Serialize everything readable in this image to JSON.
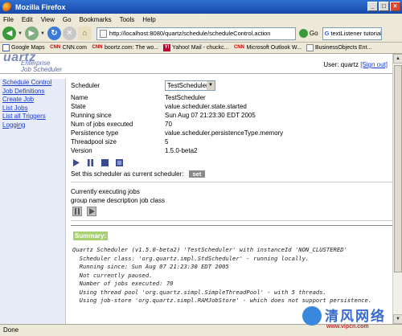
{
  "window": {
    "title": "Mozilla Firefox"
  },
  "menu": [
    "File",
    "Edit",
    "View",
    "Go",
    "Bookmarks",
    "Tools",
    "Help"
  ],
  "address": {
    "url": "http://localhost:8080/quartz/schedule/scheduleControl.action",
    "go_label": "Go"
  },
  "search": {
    "value": "textListener tutorial"
  },
  "bookmarks": [
    "Google Maps",
    "CNN.com",
    "boortz.com: The wo...",
    "Yahoo! Mail - chuckc...",
    "Microsoft Outlook W...",
    "BusinessObjects Ent..."
  ],
  "app": {
    "logo_big": "uartz",
    "logo_line1": "Enterprise",
    "logo_line2": "Job Scheduler",
    "user_label": "User: quartz",
    "sign_out": "[Sign out]"
  },
  "sidebar": {
    "items": [
      {
        "label": "Schedule Control"
      },
      {
        "label": "Job Definitions"
      },
      {
        "label": "Create Job"
      },
      {
        "label": "List Jobs"
      },
      {
        "label": "List all Triggers"
      },
      {
        "label": "Logging"
      }
    ]
  },
  "scheduler": {
    "select_label": "Scheduler",
    "select_value": "TestScheduler",
    "fields": [
      {
        "label": "Name",
        "value": "TestScheduler"
      },
      {
        "label": "State",
        "value": "value.scheduler.state.started"
      },
      {
        "label": "Running since",
        "value": "Sun Aug 07 21:23:30 EDT 2005"
      },
      {
        "label": "Num of jobs executed",
        "value": "70"
      },
      {
        "label": "Persistence type",
        "value": "value.scheduler.persistenceType.memory"
      },
      {
        "label": "Threadpool size",
        "value": "5"
      },
      {
        "label": "Version",
        "value": "1.5.0-beta2"
      }
    ],
    "set_current_label": "Set this scheduler as current scheduler:",
    "set_button": "set"
  },
  "executing": {
    "title": "Currently executing jobs",
    "columns": "group name description job class"
  },
  "summary": {
    "label": "Summary:",
    "text": "Quartz Scheduler (v1.5.0-beta2) 'TestScheduler' with instanceId 'NON_CLUSTERED'\n  Scheduler class: 'org.quartz.impl.StdScheduler' - running locally.\n  Running since: Sun Aug 07 21:23:30 EDT 2005\n  Not currently paused.\n  Number of jobs executed: 70\n  Using thread pool 'org.quartz.simpl.SimpleThreadPool' - with 5 threads.\n  Using job-store 'org.quartz.simpl.RAMJobStore' - which does not support persistence."
  },
  "status": {
    "text": "Done"
  },
  "watermark": {
    "title": "清风网络",
    "url": "www.vipcn.com"
  }
}
